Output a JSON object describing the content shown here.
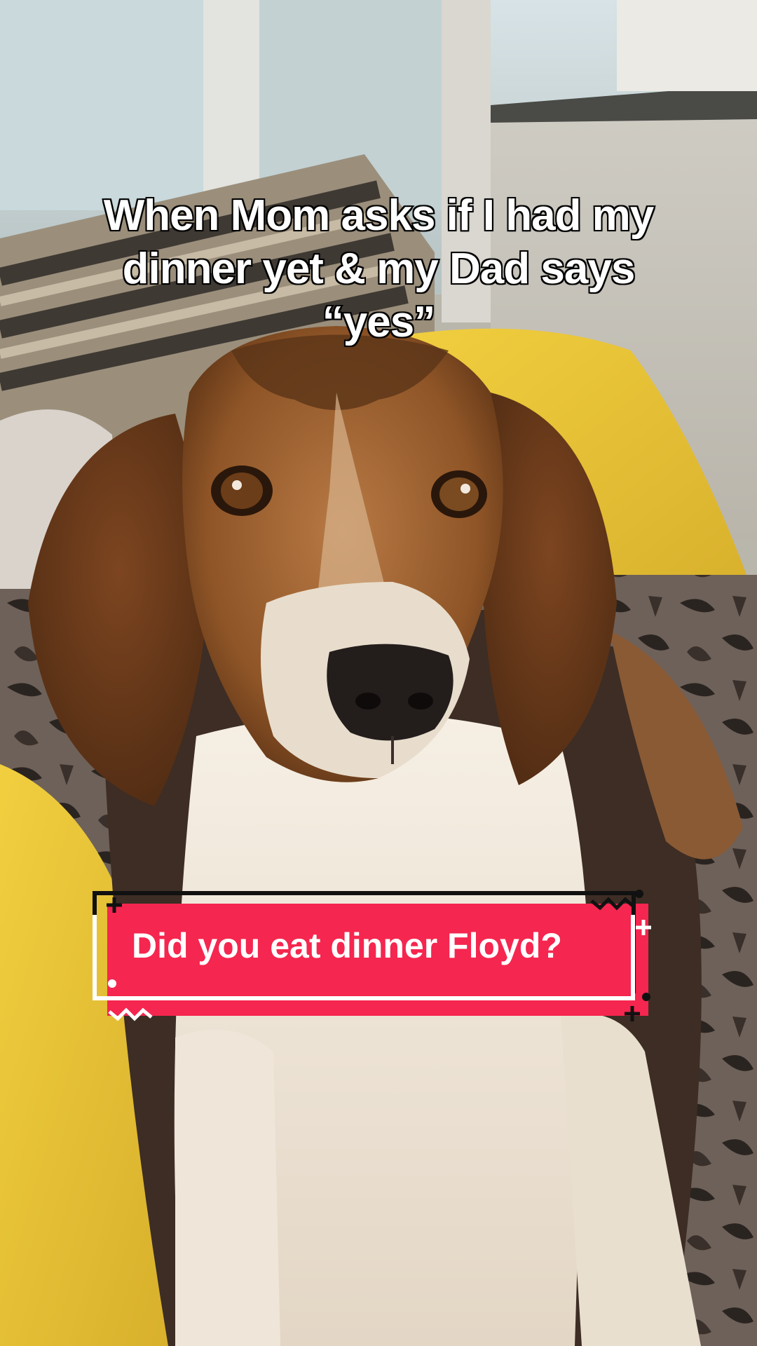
{
  "caption": {
    "line1": "When Mom asks if I had my",
    "line2": "dinner yet & my Dad says",
    "line3": "“yes”"
  },
  "question": {
    "text": "Did you eat dinner Floyd?"
  },
  "colors": {
    "accent": "#f5264f",
    "caption_text": "#ffffff",
    "caption_outline": "#000000"
  },
  "icons": [
    "plus-sparkle-icon",
    "zigzag-icon",
    "dot-icon"
  ]
}
